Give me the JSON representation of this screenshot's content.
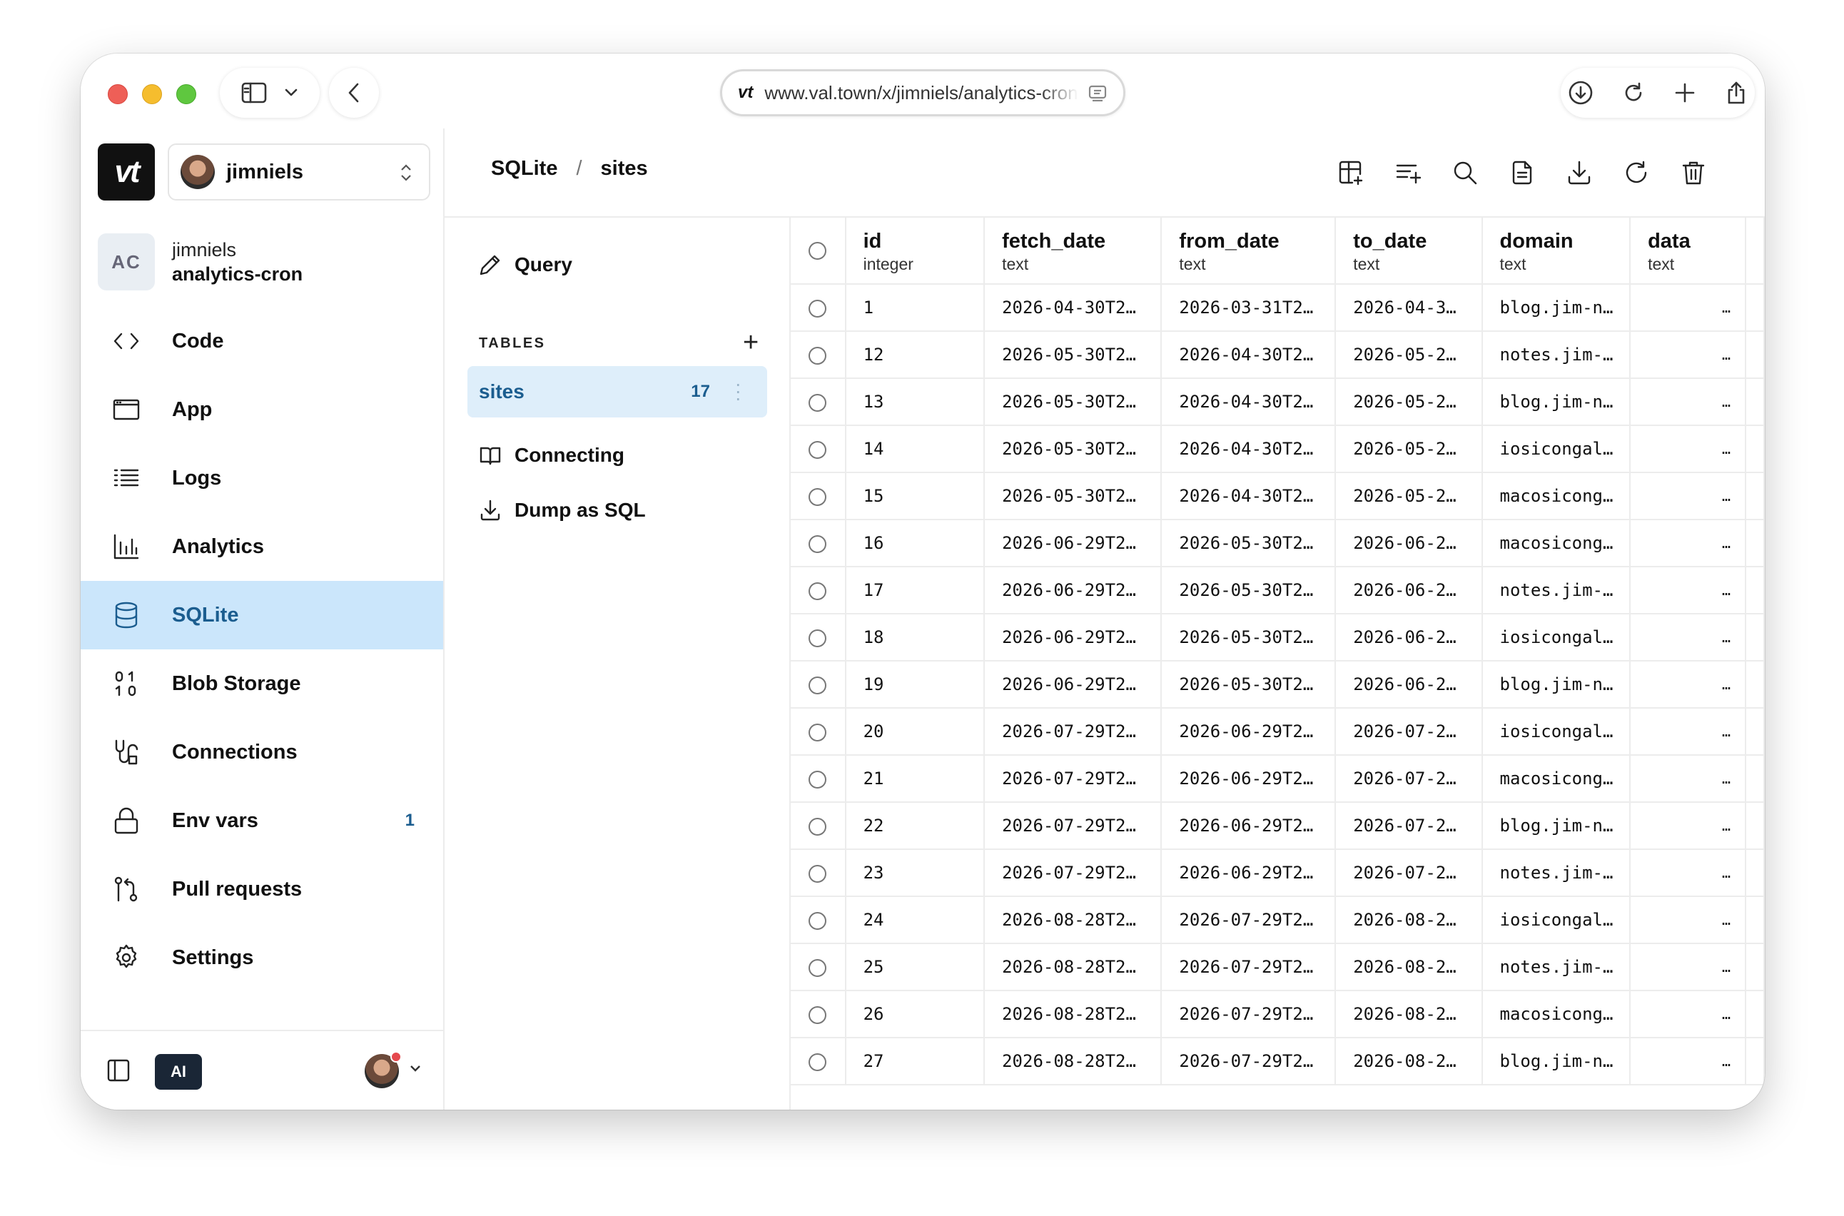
{
  "browser": {
    "url": "www.val.town/x/jimniels/analytics-cron",
    "url_logo": "vt"
  },
  "sidebar": {
    "logo": "vt",
    "user": "jimniels",
    "project": {
      "badge": "AC",
      "owner": "jimniels",
      "name": "analytics-cron"
    },
    "items": [
      {
        "label": "Code",
        "icon": "code-icon"
      },
      {
        "label": "App",
        "icon": "browser-window-icon"
      },
      {
        "label": "Logs",
        "icon": "list-icon"
      },
      {
        "label": "Analytics",
        "icon": "bar-chart-icon"
      },
      {
        "label": "SQLite",
        "icon": "database-icon",
        "active": true
      },
      {
        "label": "Blob Storage",
        "icon": "binary-icon"
      },
      {
        "label": "Connections",
        "icon": "plug-icon"
      },
      {
        "label": "Env vars",
        "icon": "lock-icon",
        "count": "1"
      },
      {
        "label": "Pull requests",
        "icon": "git-pull-request-icon"
      },
      {
        "label": "Settings",
        "icon": "gear-icon"
      }
    ],
    "footer": {
      "ai_label": "AI"
    }
  },
  "header": {
    "crumb_root": "SQLite",
    "crumb_sep": "/",
    "crumb_table": "sites",
    "toolbar": [
      "add-column-icon",
      "add-row-icon",
      "search-icon",
      "file-icon",
      "download-icon",
      "refresh-icon",
      "trash-icon"
    ]
  },
  "midpanel": {
    "query_label": "Query",
    "tables_heading": "TABLES",
    "tables": [
      {
        "name": "sites",
        "count": "17"
      }
    ],
    "connecting_label": "Connecting",
    "dump_label": "Dump as SQL"
  },
  "grid": {
    "columns": [
      {
        "name": "id",
        "type": "integer"
      },
      {
        "name": "fetch_date",
        "type": "text"
      },
      {
        "name": "from_date",
        "type": "text"
      },
      {
        "name": "to_date",
        "type": "text"
      },
      {
        "name": "domain",
        "type": "text"
      },
      {
        "name": "data",
        "type": "text"
      }
    ],
    "rows": [
      [
        "1",
        "2026-04-30T2…",
        "2026-03-31T2…",
        "2026-04-3…",
        "blog.jim-n…",
        "…"
      ],
      [
        "12",
        "2026-05-30T2…",
        "2026-04-30T2…",
        "2026-05-2…",
        "notes.jim-…",
        "…"
      ],
      [
        "13",
        "2026-05-30T2…",
        "2026-04-30T2…",
        "2026-05-2…",
        "blog.jim-n…",
        "…"
      ],
      [
        "14",
        "2026-05-30T2…",
        "2026-04-30T2…",
        "2026-05-2…",
        "iosicongal…",
        "…"
      ],
      [
        "15",
        "2026-05-30T2…",
        "2026-04-30T2…",
        "2026-05-2…",
        "macosicong…",
        "…"
      ],
      [
        "16",
        "2026-06-29T2…",
        "2026-05-30T2…",
        "2026-06-2…",
        "macosicong…",
        "…"
      ],
      [
        "17",
        "2026-06-29T2…",
        "2026-05-30T2…",
        "2026-06-2…",
        "notes.jim-…",
        "…"
      ],
      [
        "18",
        "2026-06-29T2…",
        "2026-05-30T2…",
        "2026-06-2…",
        "iosicongal…",
        "…"
      ],
      [
        "19",
        "2026-06-29T2…",
        "2026-05-30T2…",
        "2026-06-2…",
        "blog.jim-n…",
        "…"
      ],
      [
        "20",
        "2026-07-29T2…",
        "2026-06-29T2…",
        "2026-07-2…",
        "iosicongal…",
        "…"
      ],
      [
        "21",
        "2026-07-29T2…",
        "2026-06-29T2…",
        "2026-07-2…",
        "macosicong…",
        "…"
      ],
      [
        "22",
        "2026-07-29T2…",
        "2026-06-29T2…",
        "2026-07-2…",
        "blog.jim-n…",
        "…"
      ],
      [
        "23",
        "2026-07-29T2…",
        "2026-06-29T2…",
        "2026-07-2…",
        "notes.jim-…",
        "…"
      ],
      [
        "24",
        "2026-08-28T2…",
        "2026-07-29T2…",
        "2026-08-2…",
        "iosicongal…",
        "…"
      ],
      [
        "25",
        "2026-08-28T2…",
        "2026-07-29T2…",
        "2026-08-2…",
        "notes.jim-…",
        "…"
      ],
      [
        "26",
        "2026-08-28T2…",
        "2026-07-29T2…",
        "2026-08-2…",
        "macosicong…",
        "…"
      ],
      [
        "27",
        "2026-08-28T2…",
        "2026-07-29T2…",
        "2026-08-2…",
        "blog.jim-n…",
        "…"
      ]
    ]
  },
  "colors": {
    "active_bg": "#cbe6fb",
    "active_text": "#1b5d8f",
    "table_item_bg": "#deeefa",
    "ai_button_bg": "#1a2636"
  }
}
